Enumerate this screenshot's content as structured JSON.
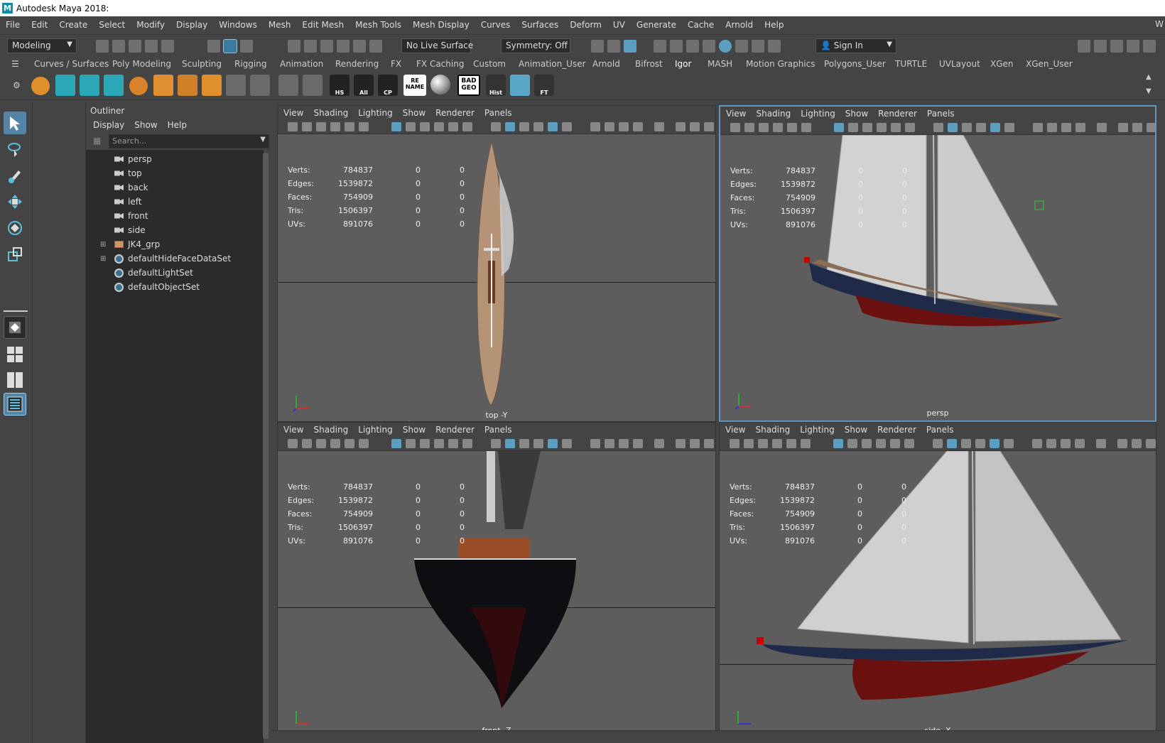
{
  "app": {
    "title": "Autodesk Maya 2018:",
    "logo_letter": "M"
  },
  "menubar": {
    "items": [
      "File",
      "Edit",
      "Create",
      "Select",
      "Modify",
      "Display",
      "Windows",
      "Mesh",
      "Edit Mesh",
      "Mesh Tools",
      "Mesh Display",
      "Curves",
      "Surfaces",
      "Deform",
      "UV",
      "Generate",
      "Cache",
      "Arnold",
      "Help"
    ],
    "overflow": "W"
  },
  "statusline": {
    "mode": "Modeling",
    "live_surface": "No Live Surface",
    "symmetry": "Symmetry: Off",
    "sign_in": "Sign In"
  },
  "shelf": {
    "tabs": [
      "Curves / Surfaces",
      "Poly Modeling",
      "Sculpting",
      "Rigging",
      "Animation",
      "Rendering",
      "FX",
      "FX Caching",
      "Custom",
      "Animation_User",
      "Arnold",
      "Bifrost",
      "Igor",
      "MASH",
      "Motion Graphics",
      "Polygons_User",
      "TURTLE",
      "UVLayout",
      "XGen",
      "XGen_User"
    ],
    "active_tab": "Igor",
    "labels": {
      "hs": "HS",
      "all": "All",
      "cp": "CP",
      "rename": "RE NAME",
      "badgeo": "BAD GEO",
      "hist": "Hist",
      "ft": "FT"
    }
  },
  "outliner": {
    "title": "Outliner",
    "menus": [
      "Display",
      "Show",
      "Help"
    ],
    "search_placeholder": "Search...",
    "items": [
      {
        "label": "persp",
        "type": "camera"
      },
      {
        "label": "top",
        "type": "camera"
      },
      {
        "label": "back",
        "type": "camera"
      },
      {
        "label": "left",
        "type": "camera"
      },
      {
        "label": "front",
        "type": "camera"
      },
      {
        "label": "side",
        "type": "camera"
      },
      {
        "label": "JK4_grp",
        "type": "group",
        "expandable": true
      },
      {
        "label": "defaultHideFaceDataSet",
        "type": "set",
        "expandable": true
      },
      {
        "label": "defaultLightSet",
        "type": "set"
      },
      {
        "label": "defaultObjectSet",
        "type": "set"
      }
    ]
  },
  "viewport_menu": [
    "View",
    "Shading",
    "Lighting",
    "Show",
    "Renderer",
    "Panels"
  ],
  "hud": {
    "labels": [
      "Verts:",
      "Edges:",
      "Faces:",
      "Tris:",
      "UVs:"
    ],
    "values": [
      "784837",
      "1539872",
      "754909",
      "1506397",
      "891076"
    ],
    "zeros": [
      "0",
      "0"
    ]
  },
  "viewports": [
    {
      "camera": "top -Y"
    },
    {
      "camera": "persp"
    },
    {
      "camera": "front -Z"
    },
    {
      "camera": "side -X"
    }
  ],
  "colors": {
    "accent": "#5b98c4",
    "hull_red": "#6b1010",
    "hull_blue": "#1e2a48",
    "deck": "#b59377",
    "sail": "#d8d8d8"
  }
}
